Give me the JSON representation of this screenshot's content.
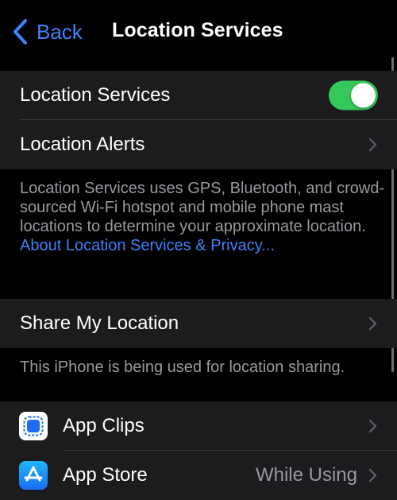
{
  "nav": {
    "back_label": "Back",
    "title": "Location Services"
  },
  "main_group": {
    "location_services_label": "Location Services",
    "location_services_enabled": true,
    "location_alerts_label": "Location Alerts"
  },
  "main_footer": {
    "text": "Location Services uses GPS, Bluetooth, and crowd-sourced Wi-Fi hotspot and mobile phone mast locations to determine your approximate location. ",
    "link": "About Location Services & Privacy..."
  },
  "share_group": {
    "share_my_location_label": "Share My Location"
  },
  "share_footer": {
    "text": "This iPhone is being used for location sharing."
  },
  "apps": [
    {
      "name": "App Clips",
      "value": "",
      "icon": "app-clips-icon"
    },
    {
      "name": "App Store",
      "value": "While Using",
      "icon": "app-store-icon"
    }
  ],
  "colors": {
    "background": "#000000",
    "cell": "#1c1c1e",
    "accent": "#3e82f7",
    "toggle_on": "#34c759",
    "secondary_text": "#98989f"
  }
}
